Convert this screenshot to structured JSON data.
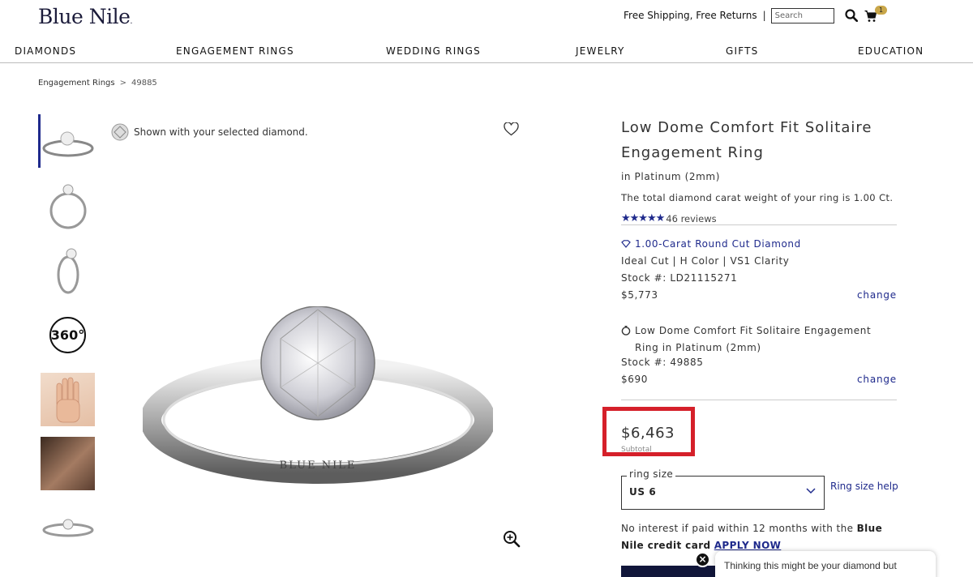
{
  "header": {
    "logo": "Blue Nile",
    "shipping": "Free Shipping, Free Returns",
    "separator": "|",
    "search_placeholder": "Search",
    "cart_count": "1"
  },
  "nav": [
    {
      "label": "DIAMONDS"
    },
    {
      "label": "ENGAGEMENT RINGS"
    },
    {
      "label": "WEDDING RINGS"
    },
    {
      "label": "JEWELRY"
    },
    {
      "label": "GIFTS"
    },
    {
      "label": "EDUCATION"
    }
  ],
  "breadcrumb": {
    "parent": "Engagement Rings",
    "separator": ">",
    "current": "49885"
  },
  "gallery": {
    "shown_note": "Shown with your selected diamond.",
    "thumb_360": "360°",
    "ring_engraving": "BLUE NILE"
  },
  "product": {
    "title": "Low Dome Comfort Fit Solitaire Engagement Ring",
    "metal": "in Platinum (2mm)",
    "carat_note": "The total diamond carat weight of your ring is 1.00 Ct.",
    "stars": "★★★★★",
    "rating": 5,
    "reviews": "46 reviews"
  },
  "diamond": {
    "title": "1.00-Carat Round Cut Diamond",
    "specs": "Ideal Cut | H Color | VS1 Clarity",
    "stock": "Stock #: LD21115271",
    "price": "$5,773",
    "change": "change"
  },
  "setting": {
    "title": "Low Dome Comfort Fit Solitaire Engagement Ring in Platinum (2mm)",
    "stock": "Stock #: 49885",
    "price": "$690",
    "change": "change"
  },
  "total": {
    "price": "$6,463",
    "label": "Subtotal"
  },
  "ring_size": {
    "legend": "ring size",
    "value": "US 6",
    "help": "Ring size help"
  },
  "finance": {
    "text_before": "No interest if paid within 12 months with the ",
    "brand": "Blue Nile",
    "text_after": " credit card",
    "apply": "APPLY NOW"
  },
  "chat": {
    "message": "Thinking this might be your diamond but",
    "close": "×"
  },
  "colors": {
    "accent": "#1f2a8c",
    "highlight_box": "#d5202a",
    "badge": "#c9a74a"
  }
}
